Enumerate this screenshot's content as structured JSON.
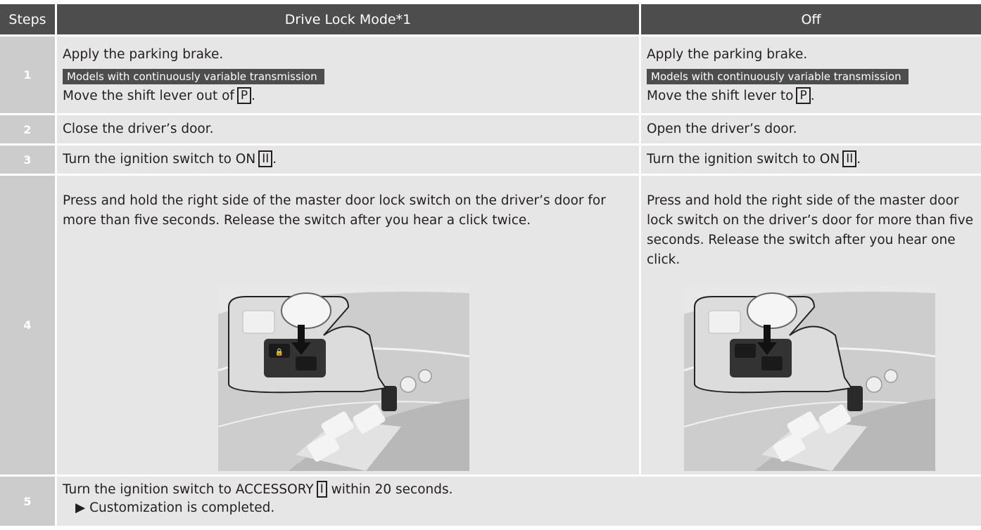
{
  "header": {
    "steps": "Steps",
    "drive_lock_mode": "Drive Lock Mode*1",
    "off": "Off"
  },
  "steps": [
    {
      "number": "1",
      "left_line1": "Apply the parking brake.",
      "left_tag": "Models with continuously variable transmission",
      "left_line2": "Move the shift lever out of",
      "left_key": "P",
      "right_line1": "Apply the parking brake.",
      "right_tag": "Models with continuously variable transmission",
      "right_line2": "Move the shift lever to",
      "right_key": "P"
    },
    {
      "number": "2",
      "left": "Close the driver’s door.",
      "right": "Open the driver’s door."
    },
    {
      "number": "3",
      "left": "Turn the ignition switch to ON",
      "left_key": "II",
      "right": "Turn the ignition switch to ON",
      "right_key": "II"
    },
    {
      "number": "4",
      "left": "Press and hold the right side of the master door lock switch on the driver’s door for more than five seconds. Release the switch after you hear a click twice.",
      "right": "Press and hold the right side of the master door lock switch on the driver’s door for more than five seconds. Release the switch after you hear one click."
    },
    {
      "number": "5",
      "text_before": "Turn the ignition switch to ACCESSORY",
      "key": "I",
      "text_after": "within 20 seconds.",
      "result_marker": "▶",
      "result": "Customization is completed."
    }
  ],
  "colors": {
    "header_bg": "#4d4d4d",
    "step_number_bg": "#cccccc",
    "cell_bg": "#e6e6e6",
    "tag_bg": "#4d4d4d"
  },
  "icons": {
    "illustration": "door-lock-switch-illustration",
    "arrow": "arrow-down-icon",
    "lock": "lock-icon",
    "unlock": "unlock-icon"
  }
}
